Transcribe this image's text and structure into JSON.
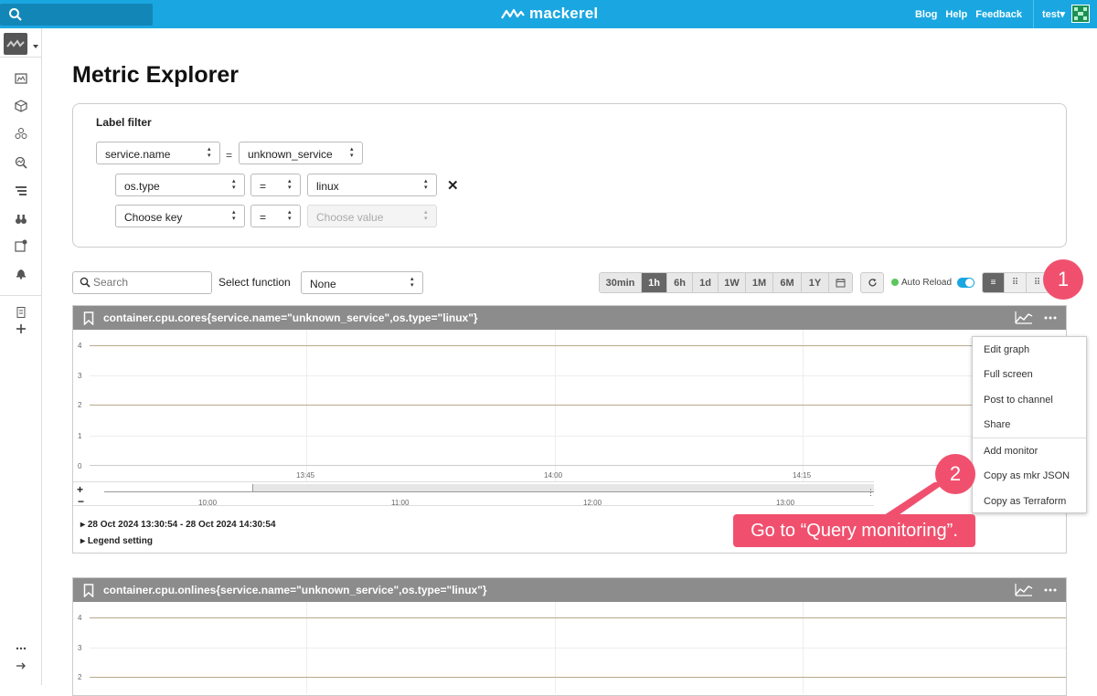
{
  "header": {
    "brand": "mackerel",
    "links": [
      "Blog",
      "Help",
      "Feedback"
    ],
    "user": "test▾"
  },
  "page": {
    "title": "Metric Explorer"
  },
  "filter": {
    "label": "Label filter",
    "row1": {
      "key": "service.name",
      "op": "=",
      "value": "unknown_service"
    },
    "row2": {
      "key": "os.type",
      "op": "=",
      "value": "linux"
    },
    "row3": {
      "key": "Choose key",
      "op": "=",
      "value": "Choose value"
    },
    "remove": "✕"
  },
  "toolbar": {
    "search_placeholder": "Search",
    "function_label": "Select function",
    "function_value": "None",
    "ranges": [
      "30min",
      "1h",
      "6h",
      "1d",
      "1W",
      "1M",
      "6M",
      "1Y"
    ],
    "active_range": "1h",
    "auto_reload": "Auto Reload"
  },
  "graphs": [
    {
      "title": "container.cpu.cores{service.name=\"unknown_service\",os.type=\"linux\"}",
      "y_ticks": [
        "4",
        "3",
        "2",
        "1",
        "0"
      ],
      "x_ticks": [
        "13:45",
        "14:00",
        "14:15"
      ],
      "mini_ticks": [
        "10:00",
        "11:00",
        "12:00",
        "13:00"
      ],
      "range_text": "28 Oct 2024 13:30:54 - 28 Oct 2024 14:30:54",
      "legend_text": "Legend setting",
      "zoom_in": "+",
      "zoom_out": "−"
    },
    {
      "title": "container.cpu.onlines{service.name=\"unknown_service\",os.type=\"linux\"}",
      "y_ticks": [
        "4",
        "3",
        "2"
      ]
    }
  ],
  "menu": {
    "items": [
      "Edit graph",
      "Full screen",
      "Post to channel",
      "Share",
      "Add monitor",
      "Copy as mkr JSON",
      "Copy as Terraform"
    ]
  },
  "annotations": {
    "step1": "1",
    "step2": "2",
    "callout": "Go to “Query monitoring”."
  },
  "colors": {
    "brand": "#1aa7e1",
    "accent": "#f0506e",
    "series": "#b8a98a"
  }
}
